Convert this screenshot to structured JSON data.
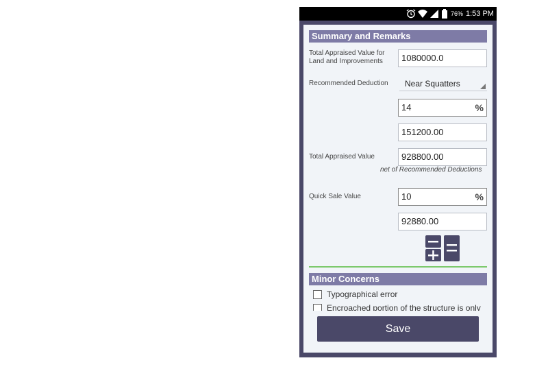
{
  "status_bar": {
    "battery": "76%",
    "time": "1:53 PM",
    "icons": [
      "alarm-icon",
      "wifi-icon",
      "signal-icon",
      "battery-icon"
    ]
  },
  "summary": {
    "header": "Summary and Remarks",
    "total_land_label": "Total Appraised Value for Land and Improvements",
    "total_land_value": "1080000.0",
    "recommended_deduction_label": "Recommended Deduction",
    "recommended_deduction_value": "Near Squatters",
    "deduction_percent": "14",
    "percent_symbol": "%",
    "deduction_amount": "151200.00",
    "total_appraised_label": "Total Appraised Value",
    "total_appraised_value": "928800.00",
    "net_note": "net of Recommended Deductions",
    "quick_sale_label": "Quick Sale Value",
    "quick_sale_percent": "10",
    "quick_sale_amount": "92880.00"
  },
  "minor_concerns": {
    "header": "Minor Concerns",
    "items": [
      {
        "label": "Typographical error",
        "checked": false
      },
      {
        "label": "Encroached portion of the structure is only",
        "checked": false
      }
    ]
  },
  "save_label": "Save",
  "colors": {
    "header_bg": "#7e7ba6",
    "button_bg": "#4a4868",
    "divider": "#7cc96c",
    "card_bg": "#f1f4f8"
  }
}
